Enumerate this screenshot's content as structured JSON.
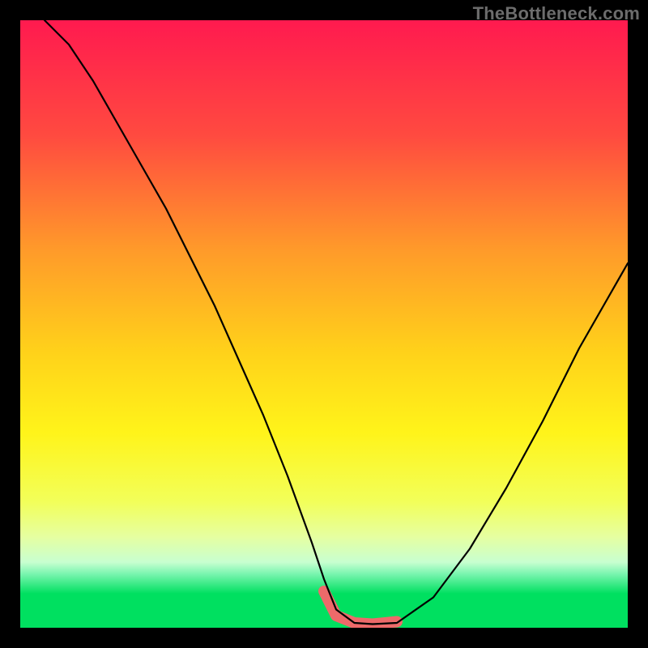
{
  "watermark": "TheBottleneck.com",
  "chart_data": {
    "type": "line",
    "title": "",
    "xlabel": "",
    "ylabel": "",
    "xlim": [
      0,
      100
    ],
    "ylim": [
      0,
      100
    ],
    "gradient_stops": [
      {
        "offset": 0.0,
        "color": "#ff1a4f"
      },
      {
        "offset": 0.2,
        "color": "#ff4a40"
      },
      {
        "offset": 0.4,
        "color": "#ff9a2a"
      },
      {
        "offset": 0.58,
        "color": "#ffd21a"
      },
      {
        "offset": 0.72,
        "color": "#fff41a"
      },
      {
        "offset": 0.84,
        "color": "#f2ff5a"
      },
      {
        "offset": 0.9,
        "color": "#e6ffa0"
      },
      {
        "offset": 0.945,
        "color": "#c8ffd0"
      },
      {
        "offset": 0.965,
        "color": "#7bf5b0"
      },
      {
        "offset": 1.0,
        "color": "#00e060"
      }
    ],
    "series": [
      {
        "name": "bottleneck-curve",
        "color": "#000000",
        "x": [
          4,
          8,
          12,
          16,
          20,
          24,
          28,
          32,
          36,
          40,
          44,
          48,
          50,
          52,
          55,
          58,
          62,
          68,
          74,
          80,
          86,
          92,
          96,
          100
        ],
        "y": [
          100,
          96,
          90,
          83,
          76,
          69,
          61,
          53,
          44,
          35,
          25,
          14,
          8,
          3,
          0.8,
          0.6,
          0.8,
          5,
          13,
          23,
          34,
          46,
          53,
          60
        ]
      },
      {
        "name": "highlight-band",
        "color": "#ed6a6a",
        "x": [
          50,
          52,
          55,
          58,
          62
        ],
        "y": [
          6,
          2,
          0.8,
          0.6,
          1.0
        ]
      }
    ]
  }
}
